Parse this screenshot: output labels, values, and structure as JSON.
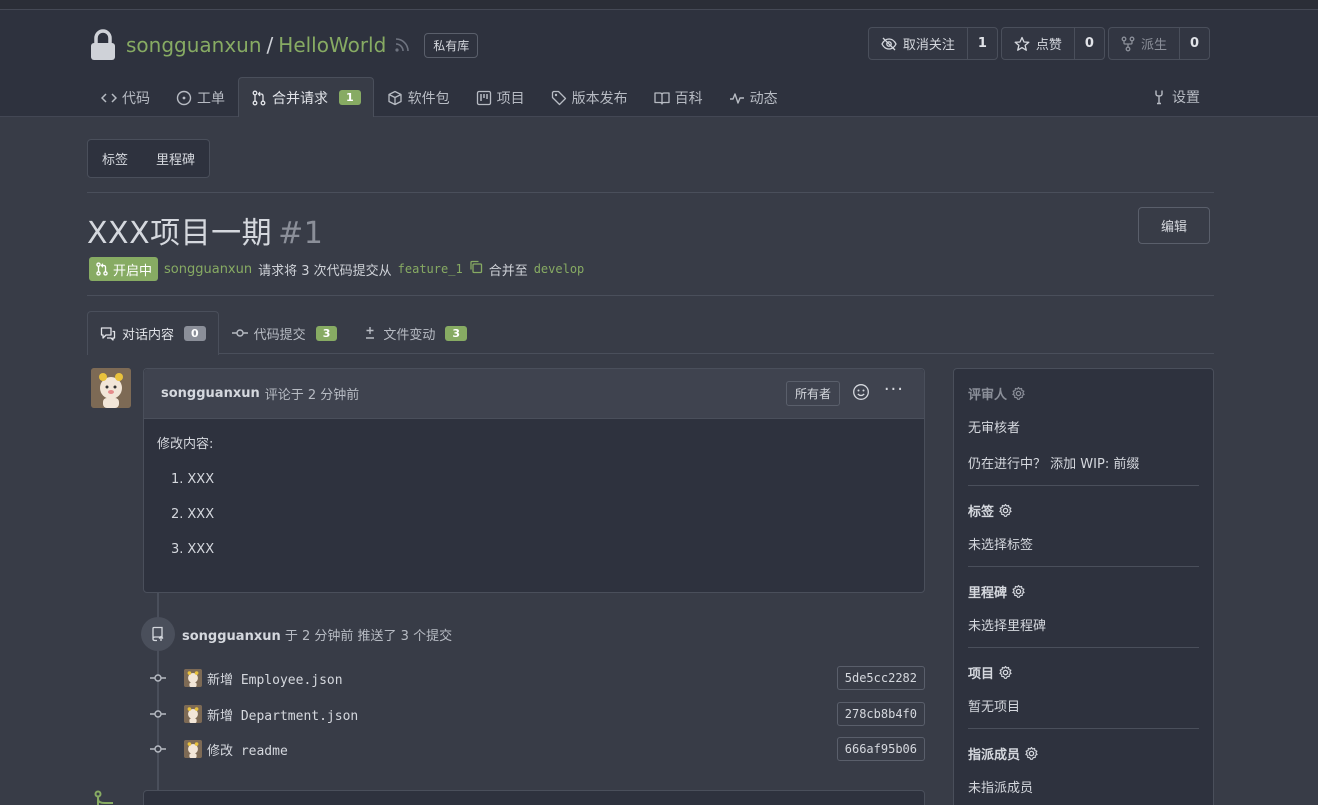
{
  "repo": {
    "owner": "songguanxun",
    "separator": "/",
    "name": "HelloWorld",
    "private_badge": "私有库",
    "accent_color": "#87ab63"
  },
  "actions": {
    "unwatch": {
      "label": "取消关注",
      "count": "1",
      "icon": "eye-slash-icon"
    },
    "star": {
      "label": "点赞",
      "count": "0",
      "icon": "star-icon"
    },
    "fork": {
      "label": "派生",
      "count": "0",
      "icon": "fork-icon"
    }
  },
  "tabs": [
    {
      "label": "代码",
      "icon": "code-icon"
    },
    {
      "label": "工单",
      "icon": "issue-icon"
    },
    {
      "label": "合并请求",
      "icon": "pull-request-icon",
      "count": "1"
    },
    {
      "label": "软件包",
      "icon": "package-icon"
    },
    {
      "label": "项目",
      "icon": "project-icon"
    },
    {
      "label": "版本发布",
      "icon": "tag-icon"
    },
    {
      "label": "百科",
      "icon": "book-icon"
    },
    {
      "label": "动态",
      "icon": "pulse-icon"
    }
  ],
  "settings_label": "设置",
  "submenu": {
    "labels": "标签",
    "milestones": "里程碑"
  },
  "pr": {
    "title": "XXX项目一期",
    "number": "#1",
    "edit_label": "编辑",
    "state": "开启中",
    "author": "songguanxun",
    "meta_text_1": "请求将 3 次代码提交从",
    "head_branch": "feature_1",
    "meta_text_2": "合并至",
    "base_branch": "develop"
  },
  "pr_tabs": [
    {
      "label": "对话内容",
      "count": "0",
      "icon": "comments-icon"
    },
    {
      "label": "代码提交",
      "count": "3",
      "icon": "commit-icon"
    },
    {
      "label": "文件变动",
      "count": "3",
      "icon": "diff-icon"
    }
  ],
  "comment": {
    "user": "songguanxun",
    "time": "评论于 2 分钟前",
    "role": "所有者",
    "more": "···",
    "intro": "修改内容:",
    "items": [
      {
        "n": "1.",
        "text": "XXX"
      },
      {
        "n": "2.",
        "text": "XXX"
      },
      {
        "n": "3.",
        "text": "XXX"
      }
    ]
  },
  "push_event": {
    "user": "songguanxun",
    "text": "于 2 分钟前 推送了 3 个提交"
  },
  "commits": [
    {
      "message": "新增 Employee.json",
      "sha": "5de5cc2282"
    },
    {
      "message": "新增 Department.json",
      "sha": "278cb8b4f0"
    },
    {
      "message": "修改 readme",
      "sha": "666af95b06"
    }
  ],
  "sidebar": {
    "reviewers_title": "评审人",
    "reviewers_value": "无审核者",
    "wip_prefix": "仍在进行中？",
    "wip_link": "添加 WIP: 前缀",
    "labels_title": "标签",
    "labels_value": "未选择标签",
    "milestone_title": "里程碑",
    "milestone_value": "未选择里程碑",
    "projects_title": "项目",
    "projects_value": "暂无项目",
    "assignees_title": "指派成员",
    "assignees_value": "未指派成员"
  }
}
